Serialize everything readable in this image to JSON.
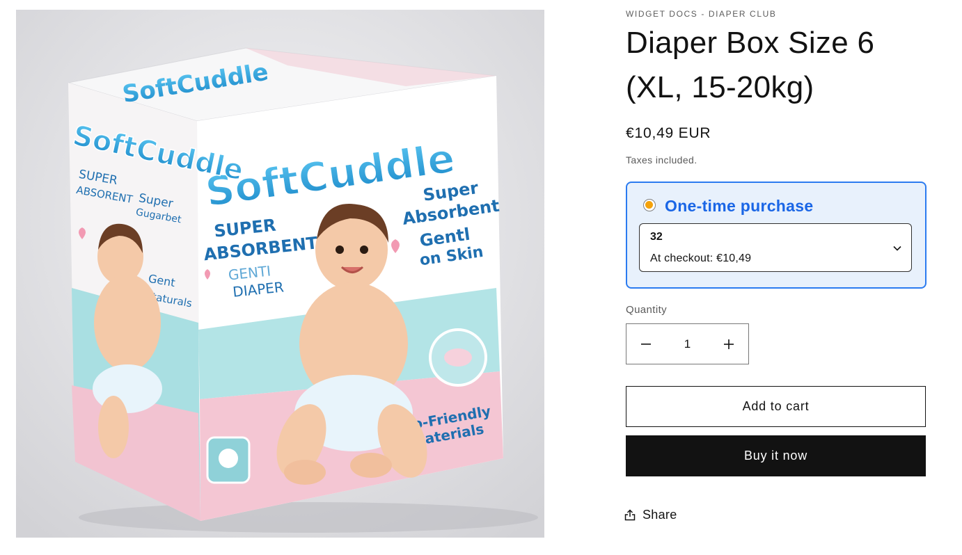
{
  "product": {
    "vendor": "WIDGET DOCS - DIAPER CLUB",
    "title": "Diaper Box Size 6 (XL, 15-20kg)",
    "price": "€10,49 EUR",
    "tax_note": "Taxes included."
  },
  "image": {
    "brand": "SoftCuddle",
    "front_texts": [
      "SUPER",
      "ABSORBENT",
      "GENTI",
      "DIAPER"
    ],
    "right_texts": [
      "Super",
      "Absorbent",
      "Gentl",
      "on Skin"
    ],
    "bottom_text": [
      "Eco-Friendly",
      "Materials"
    ],
    "side_texts": [
      "SUPER",
      "ABSORENT",
      "Super",
      "Gugarbet",
      "Gent",
      "Staturals"
    ]
  },
  "purchase_widget": {
    "option_label": "One-time purchase",
    "selected_quantity": "32",
    "checkout_line": "At checkout: €10,49",
    "accent_color": "#2b7bf0",
    "radio_color": "#f4a20b"
  },
  "quantity": {
    "label": "Quantity",
    "value": "1"
  },
  "buttons": {
    "add_to_cart": "Add to cart",
    "buy_now": "Buy it now",
    "share": "Share"
  },
  "icons": {
    "minus": "minus-icon",
    "plus": "plus-icon",
    "dropdown": "chevron-down-icon",
    "share": "share-icon"
  }
}
